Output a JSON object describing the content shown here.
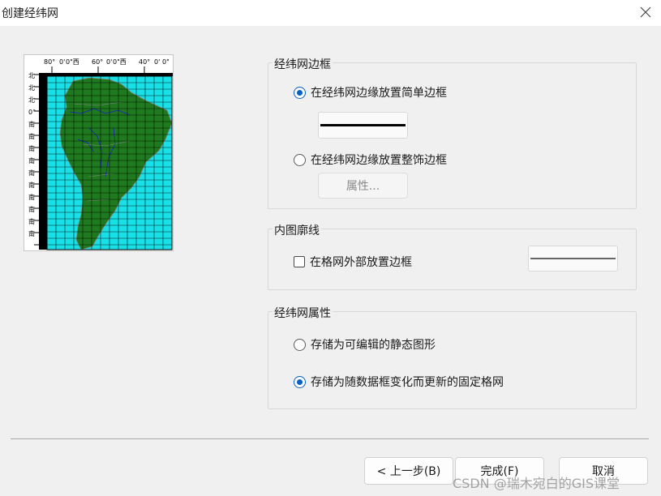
{
  "window": {
    "title": "创建经纬网"
  },
  "preview": {
    "top_labels": [
      "80°",
      "0'",
      "0\"西",
      "60°",
      "0'",
      "0\"西",
      "40°",
      "0'",
      "0\""
    ],
    "side_labels": [
      "北",
      "北",
      "北",
      "0°",
      "南",
      "南",
      "南",
      "南",
      "南",
      "南",
      "南",
      "南",
      "南",
      "南"
    ],
    "colors": {
      "ocean": "#19dfe6",
      "land": "#1f7a1f",
      "grid": "#000000",
      "rivers": "#1a1ad0"
    }
  },
  "border_group": {
    "label": "经纬网边框",
    "option_simple": "在经纬网边缘放置简单边框",
    "option_decorative": "在经纬网边缘放置整饰边框",
    "properties_button": "属性...",
    "selected": "simple"
  },
  "neatline_group": {
    "label": "内图廓线",
    "checkbox_label": "在格网外部放置边框",
    "checked": false
  },
  "graticule_group": {
    "label": "经纬网属性",
    "option_static": "存储为可编辑的静态图形",
    "option_fixed": "存储为随数据框变化而更新的固定格网",
    "selected": "fixed"
  },
  "buttons": {
    "back": "< 上一步(B)",
    "finish": "完成(F)",
    "cancel": "取消"
  },
  "watermark": "CSDN @瑞木宛白的GIS课堂",
  "colors": {
    "accent": "#0a5fc4",
    "background": "#f0f0f0"
  }
}
